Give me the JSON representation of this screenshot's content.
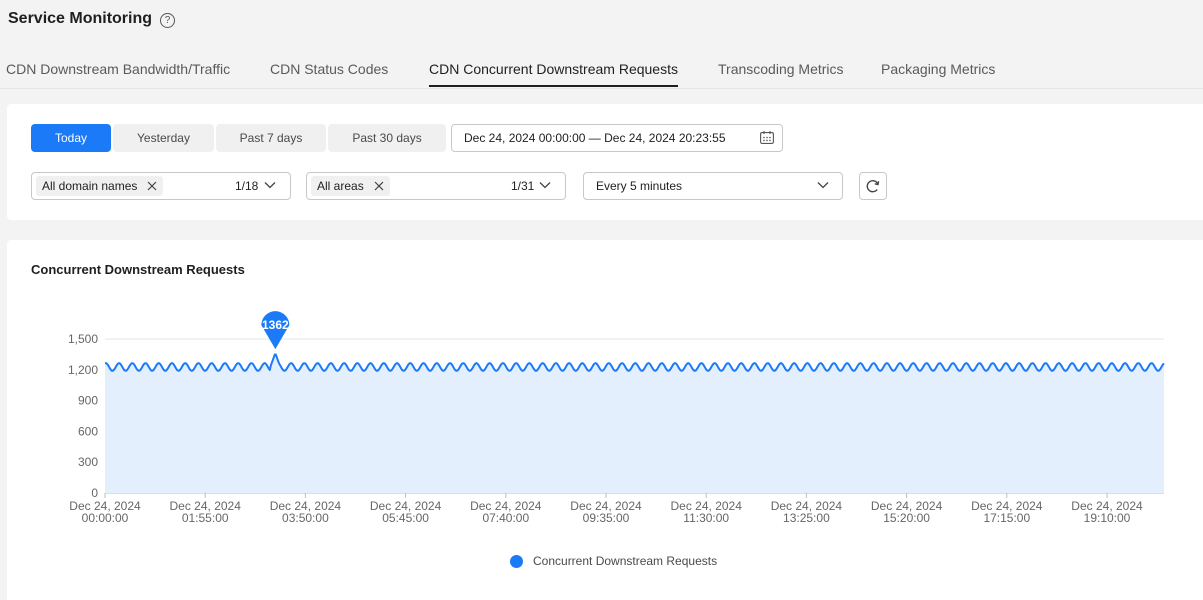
{
  "header": {
    "title": "Service Monitoring",
    "help_icon": "question-circle-icon",
    "help_glyph": "?"
  },
  "tabs": [
    {
      "label": "CDN Downstream Bandwidth/Traffic",
      "active": false
    },
    {
      "label": "CDN Status Codes",
      "active": false
    },
    {
      "label": "CDN Concurrent Downstream Requests",
      "active": true
    },
    {
      "label": "Transcoding Metrics",
      "active": false
    },
    {
      "label": "Packaging Metrics",
      "active": false
    }
  ],
  "filters": {
    "ranges": [
      {
        "label": "Today",
        "active": true
      },
      {
        "label": "Yesterday",
        "active": false
      },
      {
        "label": "Past 7 days",
        "active": false
      },
      {
        "label": "Past 30 days",
        "active": false
      }
    ],
    "date_range": "Dec 24, 2024 00:00:00 — Dec 24, 2024 20:23:55",
    "domain": {
      "tag": "All domain names",
      "count": "1/18"
    },
    "area": {
      "tag": "All areas",
      "count": "1/31"
    },
    "interval": "Every 5 minutes"
  },
  "colors": {
    "accent": "#1a7af8",
    "area_fill": "#e4effe",
    "grid": "#e6e6e6"
  },
  "chart": {
    "title": "Concurrent Downstream Requests"
  },
  "chart_data": {
    "type": "area",
    "title": "Concurrent Downstream Requests",
    "series": [
      {
        "name": "Concurrent Downstream Requests"
      }
    ],
    "baseline_value": 1230,
    "oscillation_range": [
      1190,
      1265
    ],
    "peak": {
      "x_tick_fraction": 1.7,
      "value": 1362,
      "label": "1362"
    },
    "ylim": [
      0,
      1500
    ],
    "y_ticks": [
      "0",
      "300",
      "600",
      "900",
      "1,200",
      "1,500"
    ],
    "x_ticks": [
      [
        "Dec 24, 2024",
        "00:00:00"
      ],
      [
        "Dec 24, 2024",
        "01:55:00"
      ],
      [
        "Dec 24, 2024",
        "03:50:00"
      ],
      [
        "Dec 24, 2024",
        "05:45:00"
      ],
      [
        "Dec 24, 2024",
        "07:40:00"
      ],
      [
        "Dec 24, 2024",
        "09:35:00"
      ],
      [
        "Dec 24, 2024",
        "11:30:00"
      ],
      [
        "Dec 24, 2024",
        "13:25:00"
      ],
      [
        "Dec 24, 2024",
        "15:20:00"
      ],
      [
        "Dec 24, 2024",
        "17:15:00"
      ],
      [
        "Dec 24, 2024",
        "19:10:00"
      ]
    ],
    "grid": true,
    "legend": "bottom-center"
  }
}
